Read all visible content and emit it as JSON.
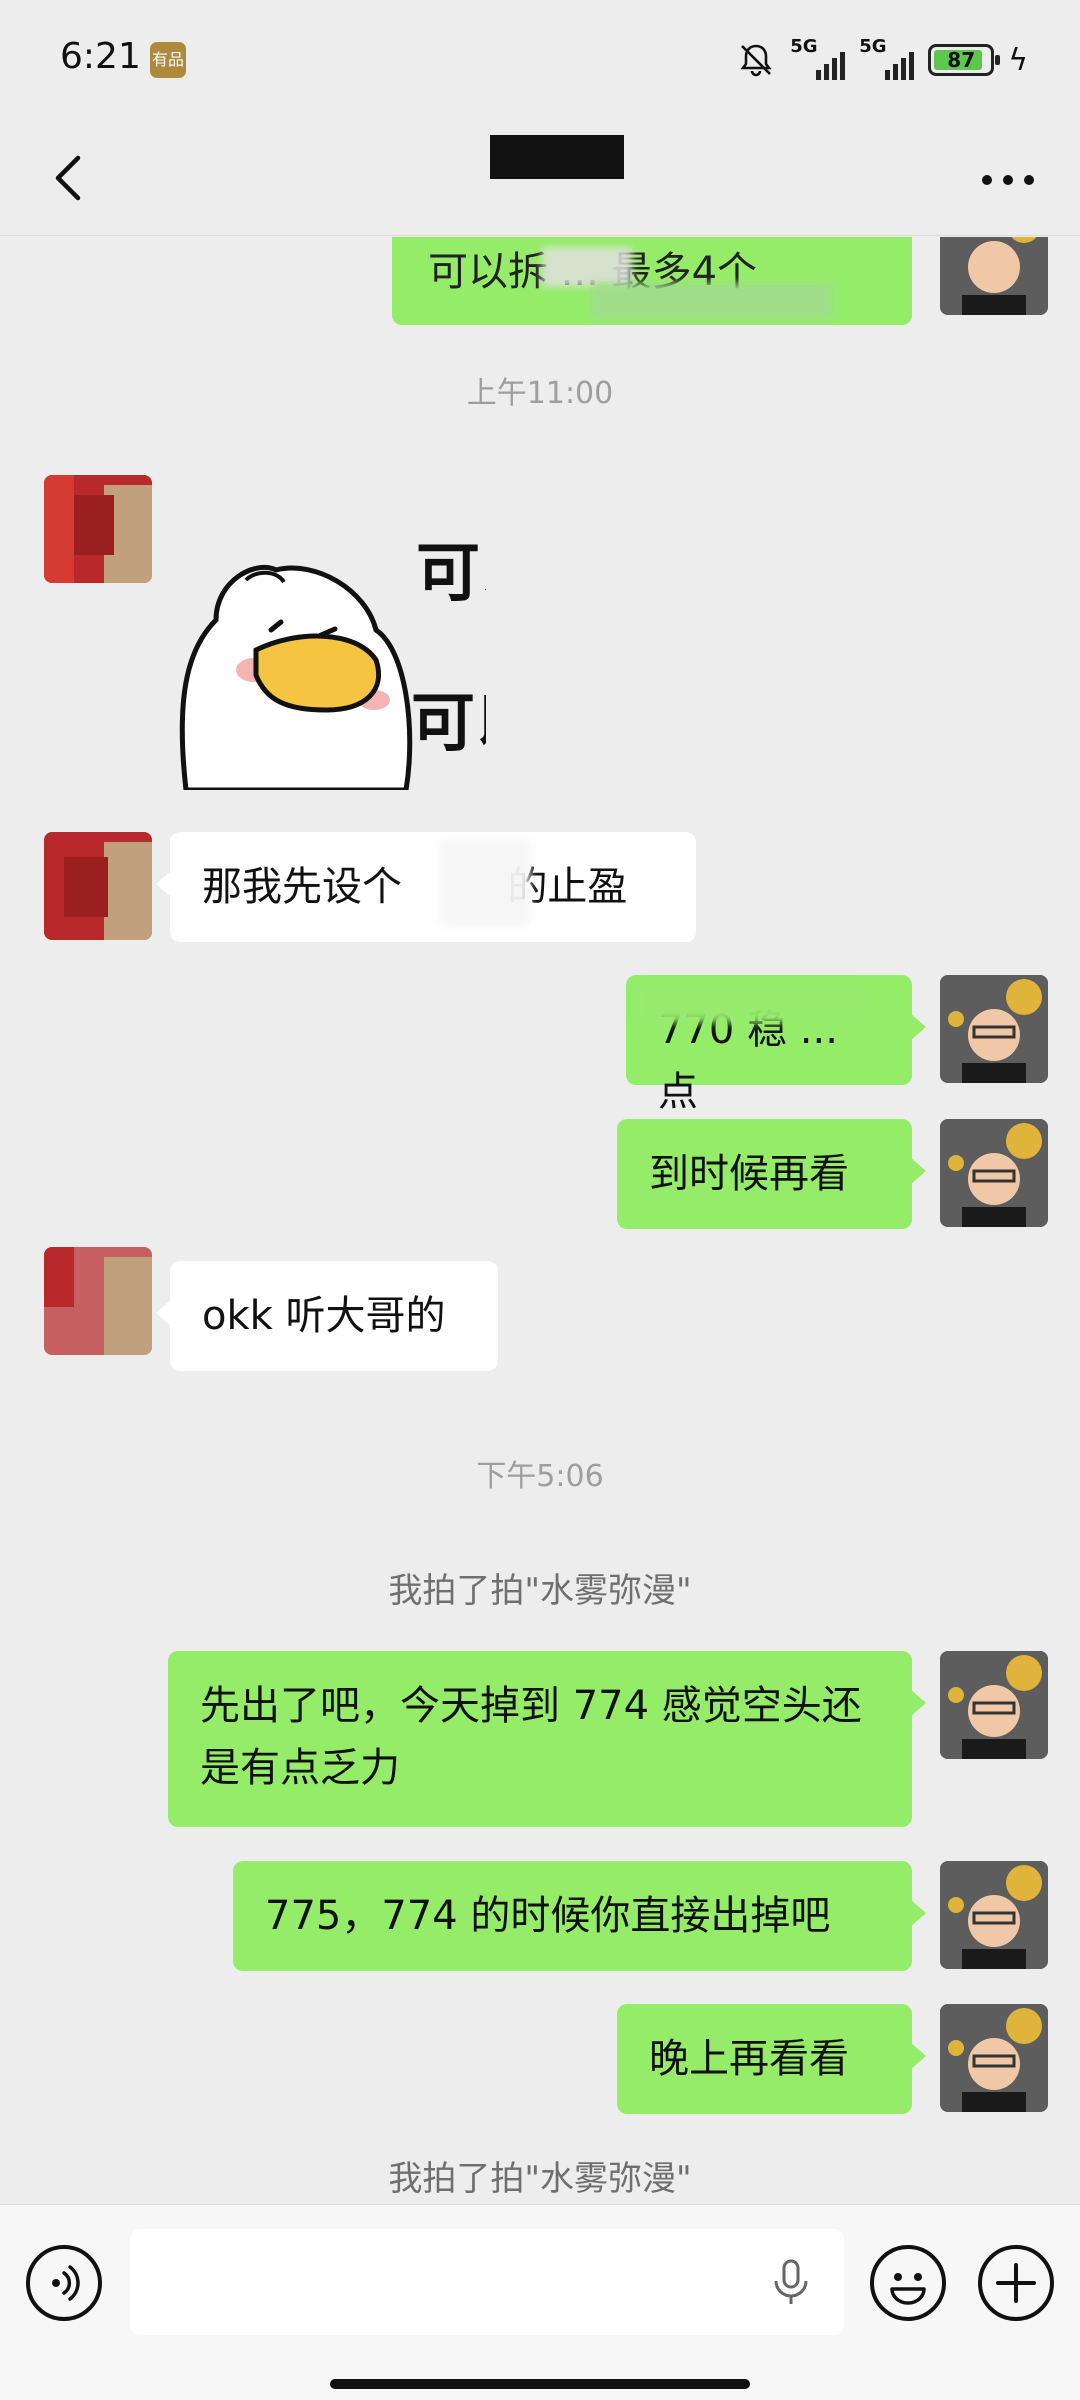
{
  "status_bar": {
    "time": "6:21",
    "badge": "有品",
    "network_1": "5G",
    "network_2": "5G",
    "battery": "87",
    "icons": [
      "bell-off-icon",
      "signal-icon",
      "battery-icon",
      "charging-icon"
    ]
  },
  "nav": {
    "back_icon": "chevron-left-icon",
    "more_icon": "more-dots-icon"
  },
  "messages": {
    "top_partial": "可以拆 ... 最多4个",
    "time_1": "上午11:00",
    "sticker_text_1": "可以",
    "sticker_text_2": "可以",
    "msg_other_1": "那我先设个",
    "msg_other_1b": "的止盈",
    "msg_me_partial": "770 稳 ... 点",
    "msg_me_1": "到时候再看",
    "msg_other_2": "okk 听大哥的",
    "time_2": "下午5:06",
    "pat_1": "我拍了拍\"水雾弥漫\"",
    "msg_me_2": "先出了吧，今天掉到 774 感觉空头还是有点乏力",
    "msg_me_3": "775，774 的时候你直接出掉吧",
    "msg_me_4": "晚上再看看",
    "pat_2": "我拍了拍\"水雾弥漫\""
  },
  "input_bar": {
    "voice_icon": "voice-icon",
    "mic_icon": "microphone-icon",
    "emoji_icon": "emoji-icon",
    "plus_icon": "plus-icon"
  },
  "colors": {
    "bubble_me": "#95ec69",
    "bubble_other": "#ffffff",
    "background": "#ededed"
  }
}
